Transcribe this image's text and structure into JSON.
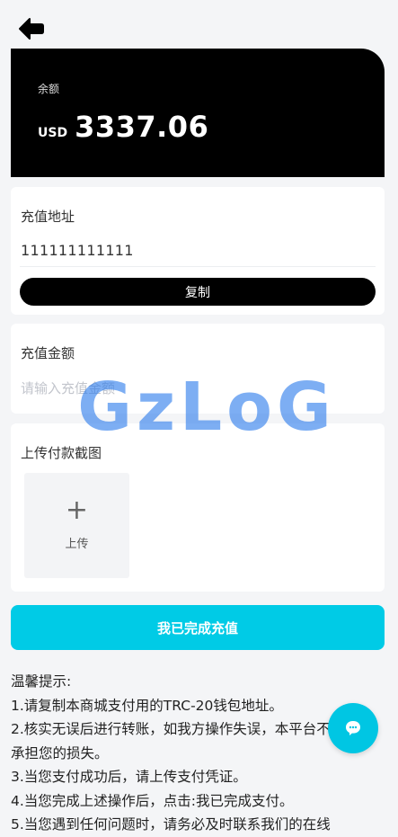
{
  "header": {
    "back_icon": "arrow-left-icon"
  },
  "balance": {
    "label": "余额",
    "currency": "USD",
    "amount": "3337.06"
  },
  "address": {
    "label": "充值地址",
    "value": "111111111111",
    "copy_label": "复制"
  },
  "amount": {
    "label": "充值金额",
    "placeholder": "请输入充值金额",
    "value": ""
  },
  "upload": {
    "label": "上传付款截图",
    "plus_icon": "plus-icon",
    "button_label": "上传"
  },
  "submit": {
    "label": "我已完成充值"
  },
  "tips": {
    "title": "温馨提示:",
    "lines": [
      "1.请复制本商城支付用的TRC-20钱包地址。",
      "2.核实无误后进行转账，如我方操作失误，本平台不",
      "承担您的损失。",
      "3.当您支付成功后，请上传支付凭证。",
      "4.当您完成上述操作后，点击:我已完成支付。",
      "5.当您遇到任何问题时，请务必及时联系我们的在线"
    ]
  },
  "watermark": "GzLoG",
  "fab": {
    "icon": "chat-bubble-icon"
  },
  "colors": {
    "accent": "#00cbe6",
    "card_bg": "#000000",
    "page_bg": "#f4f5f7"
  }
}
